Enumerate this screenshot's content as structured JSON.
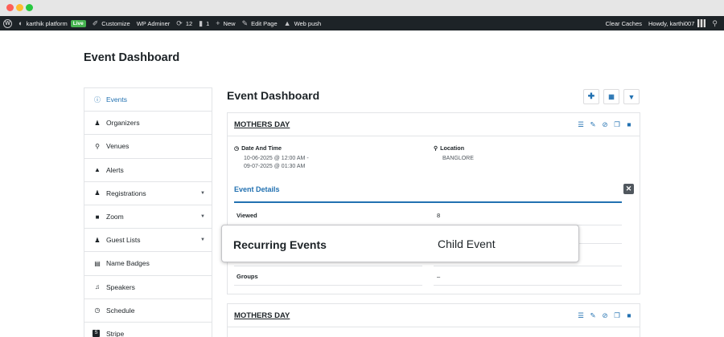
{
  "adminbar": {
    "site_name": "karthik platform",
    "live_badge": "Live",
    "customize": "Customize",
    "wp_adminer": "WP Adminer",
    "updates_count": "12",
    "comments_count": "1",
    "new": "New",
    "edit_page": "Edit Page",
    "web_push": "Web push",
    "clear_caches": "Clear Caches",
    "howdy": "Howdy, karthi007"
  },
  "page": {
    "heading": "Event Dashboard"
  },
  "sidebar": {
    "items": [
      {
        "label": "Events",
        "icon": "info-icon",
        "active": true,
        "caret": false
      },
      {
        "label": "Organizers",
        "icon": "organizer-icon",
        "caret": false
      },
      {
        "label": "Venues",
        "icon": "location-icon",
        "caret": false
      },
      {
        "label": "Alerts",
        "icon": "bell-icon",
        "caret": false
      },
      {
        "label": "Registrations",
        "icon": "users-icon",
        "caret": true
      },
      {
        "label": "Zoom",
        "icon": "video-icon",
        "caret": true
      },
      {
        "label": "Guest Lists",
        "icon": "users-icon",
        "caret": true
      },
      {
        "label": "Name Badges",
        "icon": "print-icon",
        "caret": false
      },
      {
        "label": "Speakers",
        "icon": "mic-icon",
        "caret": false
      },
      {
        "label": "Schedule",
        "icon": "clock-icon",
        "caret": false
      },
      {
        "label": "Stripe",
        "icon": "stripe-icon",
        "caret": false
      }
    ]
  },
  "main": {
    "title": "Event Dashboard",
    "cards": [
      {
        "title": "MOTHERS DAY",
        "date_label": "Date And Time",
        "date_value_1": "10-06-2025 @ 12:00 AM -",
        "date_value_2": "09-07-2025 @ 01:30 AM",
        "location_label": "Location",
        "location_value": "BANGLORE",
        "details_heading": "Event Details",
        "rows": [
          {
            "label": "Viewed",
            "value": "8"
          },
          {
            "label": "Groups",
            "value": "–"
          }
        ]
      },
      {
        "title": "MOTHERS DAY"
      }
    ]
  },
  "popup": {
    "label": "Recurring Events",
    "value": "Child Event"
  },
  "colors": {
    "accent": "#2271b1",
    "adminbar": "#1d2327",
    "live": "#46b450"
  }
}
